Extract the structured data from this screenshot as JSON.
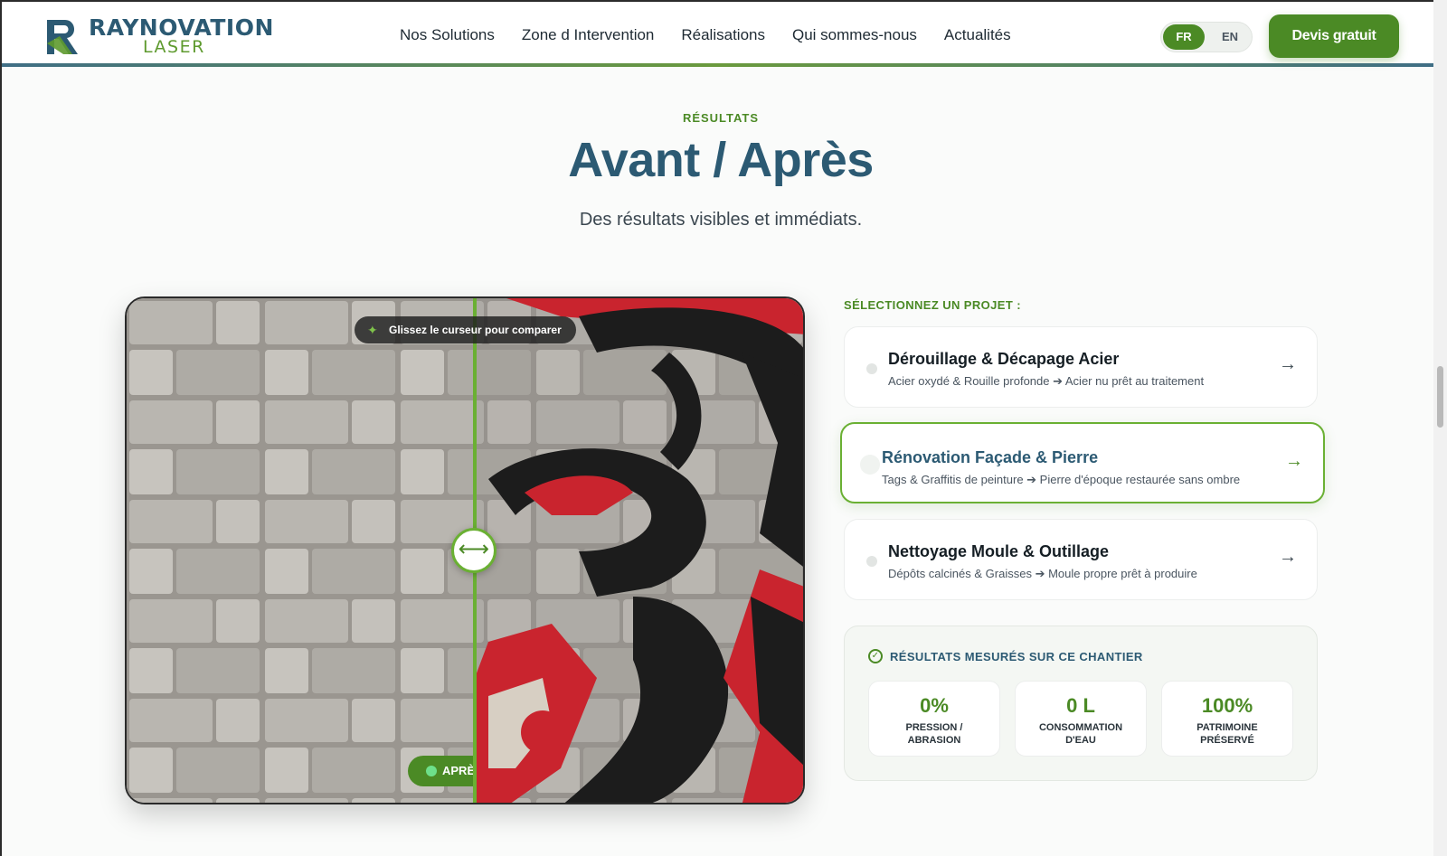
{
  "brand": {
    "name_line1": "RAYNOVATION",
    "name_line2": "LASER"
  },
  "nav": {
    "items": [
      {
        "label": "Nos Solutions"
      },
      {
        "label": "Zone d Intervention"
      },
      {
        "label": "Réalisations"
      },
      {
        "label": "Qui sommes-nous"
      },
      {
        "label": "Actualités"
      }
    ]
  },
  "language": {
    "fr": "FR",
    "en": "EN",
    "selected": "FR"
  },
  "cta": {
    "label": "Devis gratuit"
  },
  "section": {
    "eyebrow": "RÉSULTATS",
    "title": "Avant / Après",
    "subtitle": "Des résultats visibles et immédiats."
  },
  "compare": {
    "hint": "Glissez le curseur pour comparer",
    "after_label": "APRÈS",
    "slider_position": 0.51
  },
  "projects": {
    "label": "SÉLECTIONNEZ UN PROJET :",
    "items": [
      {
        "title": "Dérouillage & Décapage Acier",
        "desc": "Acier oxydé & Rouille profonde ➔ Acier nu prêt au traitement",
        "active": false
      },
      {
        "title": "Rénovation Façade & Pierre",
        "desc": "Tags & Graffitis de peinture ➔ Pierre d'époque restaurée sans ombre",
        "active": true
      },
      {
        "title": "Nettoyage Moule & Outillage",
        "desc": "Dépôts calcinés & Graisses ➔ Moule propre prêt à produire",
        "active": false
      }
    ]
  },
  "results": {
    "title": "RÉSULTATS MESURÉS SUR CE CHANTIER",
    "stats": [
      {
        "value": "0%",
        "label": "PRESSION / ABRASION"
      },
      {
        "value": "0 L",
        "label": "CONSOMMATION D'EAU"
      },
      {
        "value": "100%",
        "label": "PATRIMOINE PRÉSERVÉ"
      }
    ]
  },
  "colors": {
    "primary_green": "#4b8a25",
    "brand_blue": "#2c5a73",
    "accent_green": "#6ab033"
  }
}
